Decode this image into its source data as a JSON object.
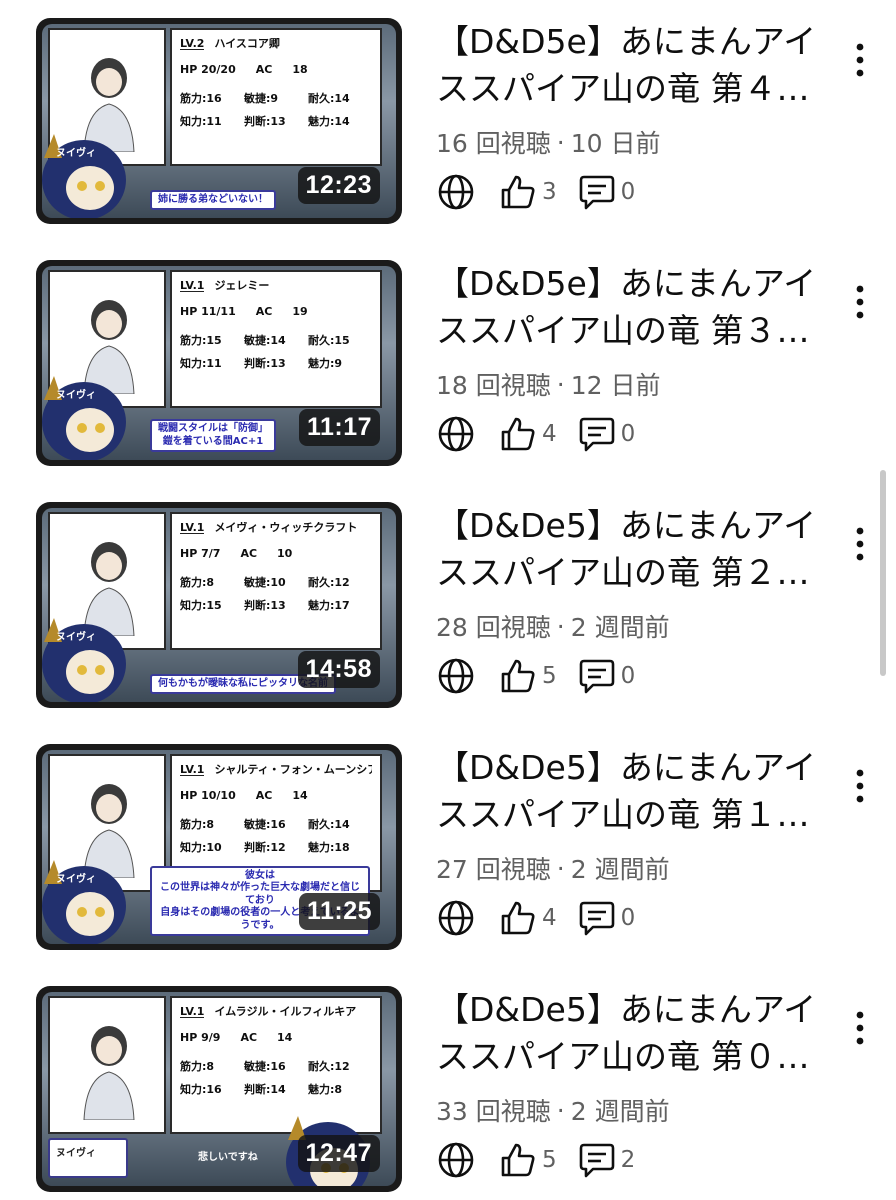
{
  "videos": [
    {
      "title": "【D&D5e】あにまんアイススパイア山の竜 第４…",
      "views": "16 回視聴",
      "separator": "·",
      "age": "10 日前",
      "likes": "3",
      "comments": "0",
      "duration": "12:23",
      "thumb": {
        "level": "LV.2",
        "name": "ハイスコア卿",
        "hp": "HP 20/20",
        "ac": "AC",
        "ac_value": "18",
        "stats": [
          "筋力:16",
          "敏捷:9",
          "耐久:14",
          "知力:11",
          "判断:13",
          "魅力:14"
        ],
        "mascot": "ヌイヴィ",
        "caption": "姉に勝る弟などいない！",
        "caption_style": "box"
      }
    },
    {
      "title": "【D&D5e】あにまんアイススパイア山の竜 第３…",
      "views": "18 回視聴",
      "separator": "·",
      "age": "12 日前",
      "likes": "4",
      "comments": "0",
      "duration": "11:17",
      "thumb": {
        "level": "LV.1",
        "name": "ジェレミー",
        "hp": "HP 11/11",
        "ac": "AC",
        "ac_value": "19",
        "stats": [
          "筋力:15",
          "敏捷:14",
          "耐久:15",
          "知力:11",
          "判断:13",
          "魅力:9"
        ],
        "mascot": "ヌイヴィ",
        "caption": "戦闘スタイルは「防御」\n鎧を着ている間AC+1",
        "caption_style": "box"
      }
    },
    {
      "title": "【D&De5】あにまんアイススパイア山の竜 第２…",
      "views": "28 回視聴",
      "separator": "·",
      "age": "2 週間前",
      "likes": "5",
      "comments": "0",
      "duration": "14:58",
      "thumb": {
        "level": "LV.1",
        "name": "メイヴィ・ウィッチクラフト",
        "hp": "HP 7/7",
        "ac": "AC",
        "ac_value": "10",
        "stats": [
          "筋力:8",
          "敏捷:10",
          "耐久:12",
          "知力:15",
          "判断:13",
          "魅力:17"
        ],
        "mascot": "ヌイヴィ",
        "caption": "何もかもが曖昧な私にピッタリな名前",
        "caption_style": "box"
      }
    },
    {
      "title": "【D&De5】あにまんアイススパイア山の竜 第１…",
      "views": "27 回視聴",
      "separator": "·",
      "age": "2 週間前",
      "likes": "4",
      "comments": "0",
      "duration": "11:25",
      "thumb": {
        "level": "LV.1",
        "name": "シャルティ・フォン・ムーンシアター",
        "hp": "HP 10/10",
        "ac": "AC",
        "ac_value": "14",
        "stats": [
          "筋力:8",
          "敏捷:16",
          "耐久:14",
          "知力:10",
          "判断:12",
          "魅力:18"
        ],
        "mascot": "ヌイヴィ",
        "caption": "彼女は\nこの世界は神々が作った巨大な劇場だと信じており\n自身はその劇場の役者の一人と考えているようです。",
        "caption_style": "box"
      }
    },
    {
      "title": "【D&De5】あにまんアイススパイア山の竜 第０…",
      "views": "33 回視聴",
      "separator": "·",
      "age": "2 週間前",
      "likes": "5",
      "comments": "2",
      "duration": "12:47",
      "thumb": {
        "level": "LV.1",
        "name": "イムラジル・イルフィルキア",
        "hp": "HP 9/9",
        "ac": "AC",
        "ac_value": "14",
        "stats": [
          "筋力:8",
          "敏捷:16",
          "耐久:12",
          "知力:16",
          "判断:14",
          "魅力:8"
        ],
        "mascot": "ヌイヴィ",
        "caption": "悲しいですね",
        "caption_style": "plain"
      }
    }
  ],
  "icons": {
    "visibility": "globe-icon",
    "like": "thumbs-up-icon",
    "comment": "comment-icon",
    "more": "more-vertical-icon"
  },
  "colors": {
    "title": "#0f0f0f",
    "meta": "#606060",
    "duration_bg": "#141414",
    "caption_text": "#2a2ab0"
  }
}
